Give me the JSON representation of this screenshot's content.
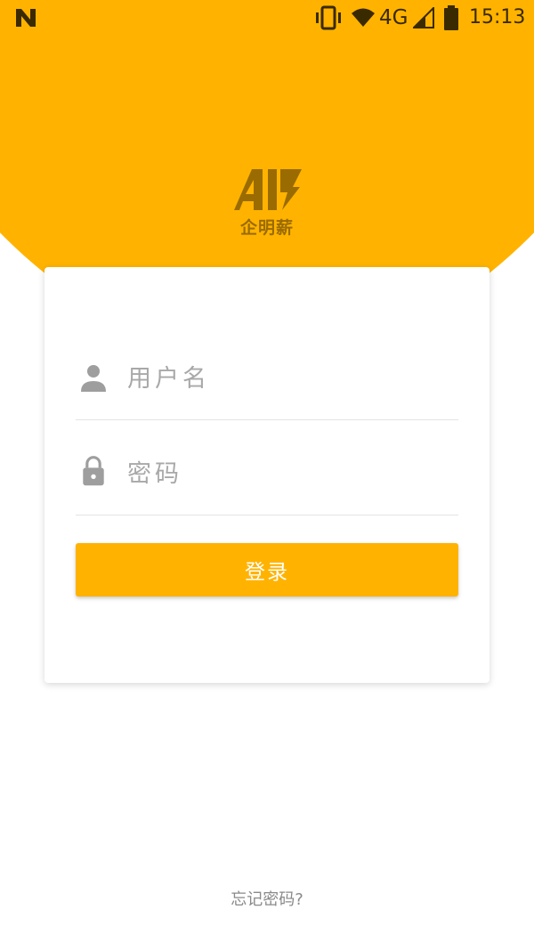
{
  "theme": {
    "accent": "#FFB300",
    "logo_color": "#9A6B00"
  },
  "status_bar": {
    "left_icon": "n-notification-icon",
    "icons": [
      "vibrate-icon",
      "wifi-icon",
      "signal-icon",
      "battery-icon"
    ],
    "network": "4G",
    "time": "15:13"
  },
  "brand": {
    "logo_icon": "brand-logo-mark",
    "name": "企明薪"
  },
  "login_form": {
    "username": {
      "icon": "person-icon",
      "placeholder": "用户名",
      "value": ""
    },
    "password": {
      "icon": "lock-icon",
      "placeholder": "密码",
      "value": ""
    },
    "submit_label": "登录"
  },
  "forgot_password_link": "忘记密码?"
}
